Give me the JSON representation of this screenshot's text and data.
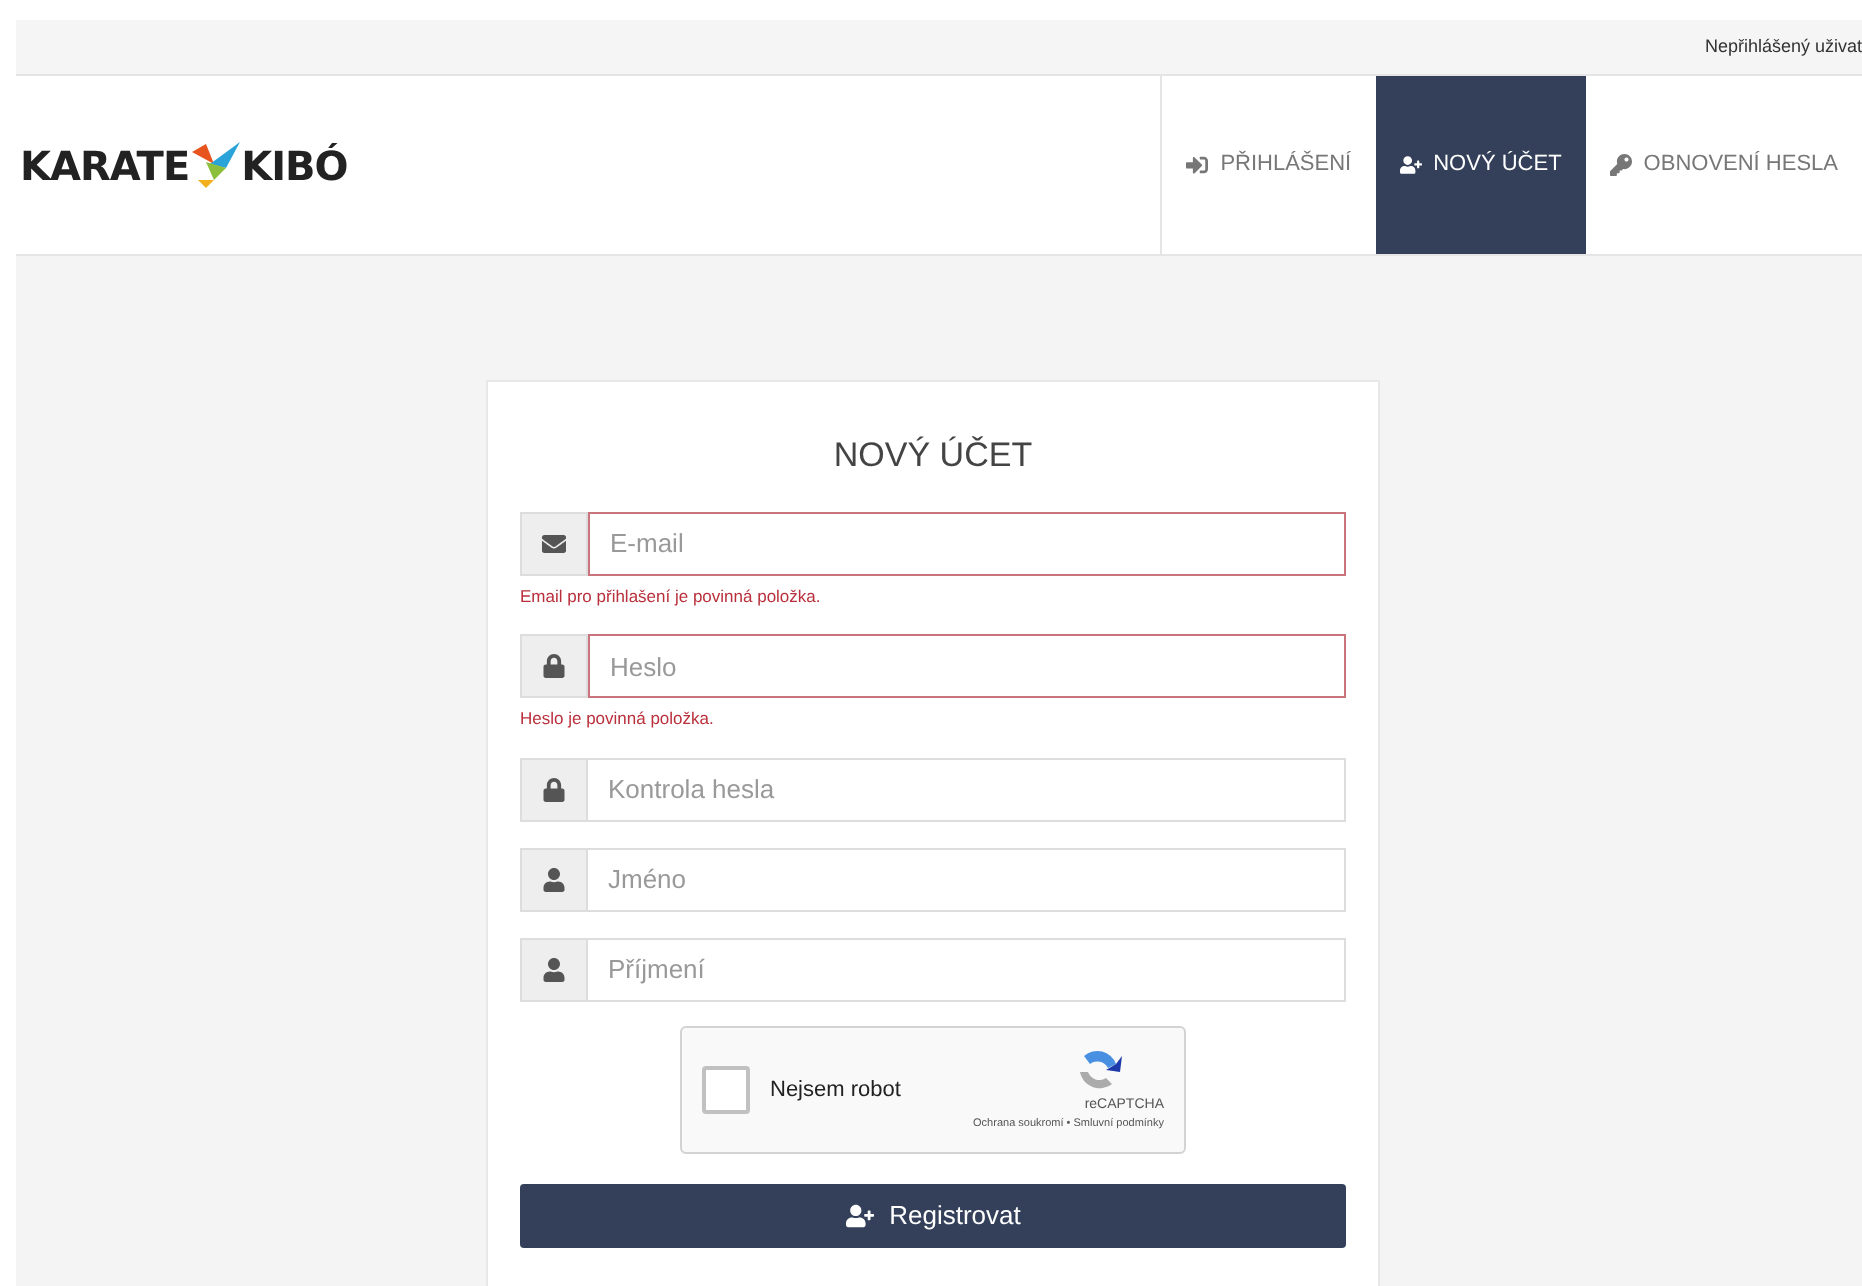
{
  "top_bar": {
    "user_status": "Nepřihlášený uživat"
  },
  "logo": {
    "left": "KARATE",
    "right": "KIBÓ"
  },
  "nav": [
    {
      "label": "PŘIHLÁŠENÍ",
      "kind": "login",
      "selected": false
    },
    {
      "label": "NOVÝ ÚČET",
      "kind": "register",
      "selected": true
    },
    {
      "label": "OBNOVENÍ HESLA",
      "kind": "reset",
      "selected": false
    }
  ],
  "form": {
    "title": "NOVÝ ÚČET",
    "fields": [
      {
        "kind": "email",
        "placeholder": "E-mail",
        "invalid": true,
        "error": "Email pro přihlašení je povinná položka."
      },
      {
        "kind": "password",
        "placeholder": "Heslo",
        "invalid": true,
        "error": "Heslo je povinná položka."
      },
      {
        "kind": "password",
        "placeholder": "Kontrola hesla",
        "invalid": false
      },
      {
        "kind": "name",
        "placeholder": "Jméno",
        "invalid": false
      },
      {
        "kind": "name",
        "placeholder": "Příjmení",
        "invalid": false
      }
    ],
    "captcha": {
      "label": "Nejsem robot",
      "checked": false,
      "brand": "reCAPTCHA",
      "links": "Ochrana soukromí • Smluvní podmínky"
    },
    "submit": "Registrovat"
  }
}
